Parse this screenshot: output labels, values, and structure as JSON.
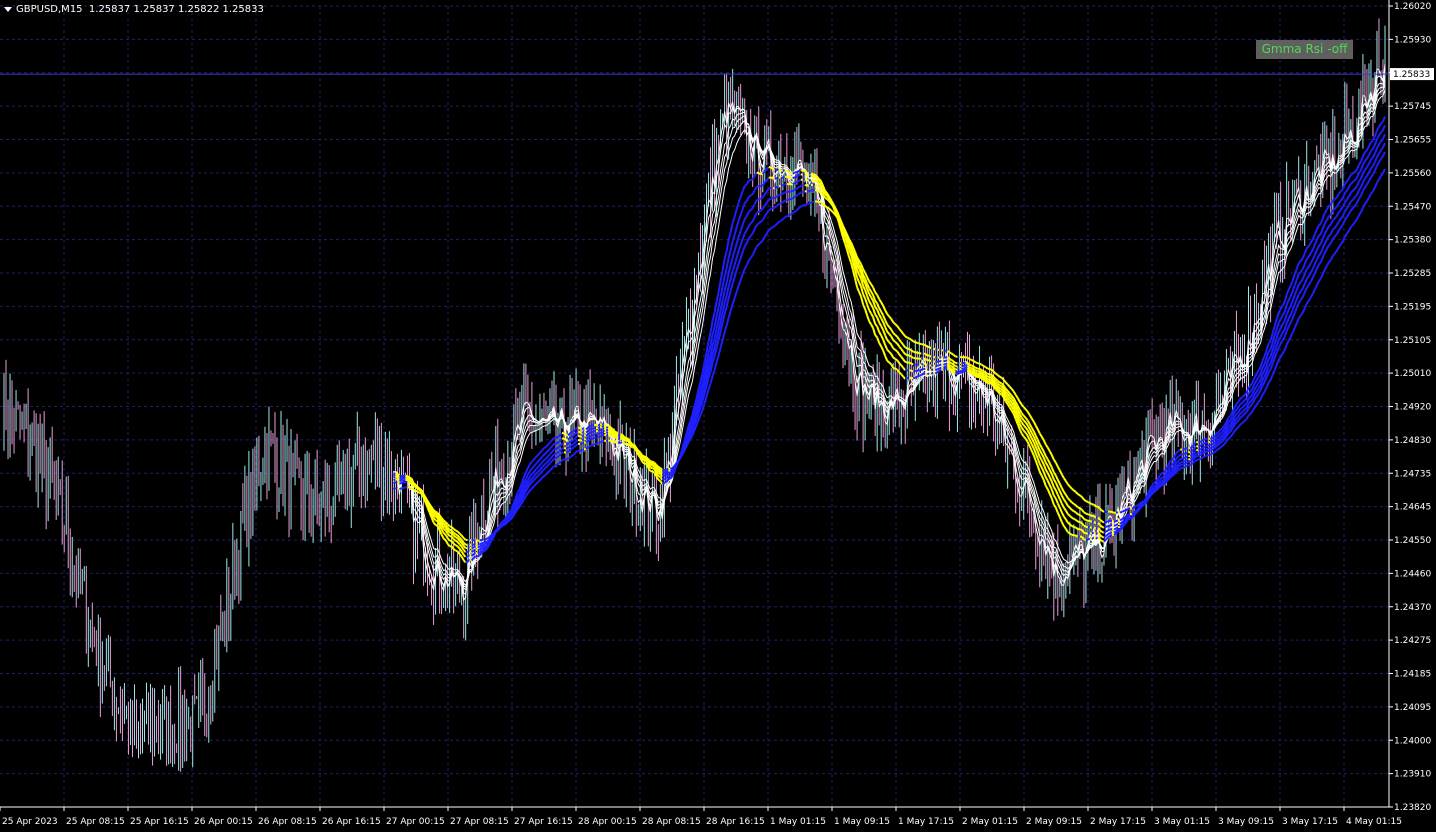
{
  "header": {
    "symbol": "GBPUSD,M15",
    "ohlc": "1.25837 1.25837 1.25822 1.25833"
  },
  "indicator_label": "Gmma Rsi -off",
  "current_price": "1.25833",
  "price_axis": [
    "1.26020",
    "1.25930",
    "1.25833",
    "1.25745",
    "1.25655",
    "1.25560",
    "1.25470",
    "1.25380",
    "1.25285",
    "1.25195",
    "1.25105",
    "1.25010",
    "1.24920",
    "1.24830",
    "1.24735",
    "1.24645",
    "1.24550",
    "1.24460",
    "1.24370",
    "1.24275",
    "1.24185",
    "1.24095",
    "1.24000",
    "1.23910",
    "1.23820"
  ],
  "time_axis": [
    "25 Apr 2023",
    "25 Apr 08:15",
    "25 Apr 16:15",
    "26 Apr 00:15",
    "26 Apr 08:15",
    "26 Apr 16:15",
    "27 Apr 00:15",
    "27 Apr 08:15",
    "27 Apr 16:15",
    "28 Apr 00:15",
    "28 Apr 08:15",
    "28 Apr 16:15",
    "1 May 01:15",
    "1 May 09:15",
    "1 May 17:15",
    "2 May 01:15",
    "2 May 09:15",
    "2 May 17:15",
    "3 May 01:15",
    "3 May 09:15",
    "3 May 17:15",
    "4 May 01:15"
  ],
  "colors": {
    "background": "#000000",
    "grid": "#1f1f6b",
    "axis": "#ffffff",
    "bid_line": "#3b3bc8",
    "candle_bull": "#9ee8e8",
    "candle_bear": "#e8a0d8",
    "ema_fast": "#ffffff",
    "ema_slow_up": "#1f1fff",
    "ema_slow_down": "#ffff00",
    "ema_fast_down": "#ff2020",
    "badge_text": "#55d655",
    "badge_bg": "#5f5f5f"
  },
  "chart_data": {
    "type": "candlestick",
    "symbol": "GBPUSD",
    "timeframe": "M15",
    "ylim": [
      1.2382,
      1.2602
    ],
    "price_path": [
      {
        "t": "25 Apr 2023",
        "p": 1.249
      },
      {
        "t": "25 Apr 08:15",
        "p": 1.246
      },
      {
        "t": "25 Apr 16:15",
        "p": 1.2395
      },
      {
        "t": "26 Apr 00:15",
        "p": 1.2412
      },
      {
        "t": "26 Apr 08:15",
        "p": 1.2475
      },
      {
        "t": "26 Apr 16:15",
        "p": 1.247
      },
      {
        "t": "27 Apr 00:15",
        "p": 1.2472
      },
      {
        "t": "27 Apr 08:15",
        "p": 1.244
      },
      {
        "t": "27 Apr 16:15",
        "p": 1.2495
      },
      {
        "t": "28 Apr 00:15",
        "p": 1.248
      },
      {
        "t": "28 Apr 08:15",
        "p": 1.247
      },
      {
        "t": "28 Apr 16:15",
        "p": 1.257
      },
      {
        "t": "1 May 01:15",
        "p": 1.2562
      },
      {
        "t": "1 May 09:15",
        "p": 1.25
      },
      {
        "t": "1 May 17:15",
        "p": 1.2495
      },
      {
        "t": "2 May 01:15",
        "p": 1.25
      },
      {
        "t": "2 May 09:15",
        "p": 1.244
      },
      {
        "t": "2 May 17:15",
        "p": 1.247
      },
      {
        "t": "3 May 01:15",
        "p": 1.2483
      },
      {
        "t": "3 May 09:15",
        "p": 1.2515
      },
      {
        "t": "3 May 17:15",
        "p": 1.256
      },
      {
        "t": "4 May 01:15",
        "p": 1.2583
      }
    ]
  }
}
